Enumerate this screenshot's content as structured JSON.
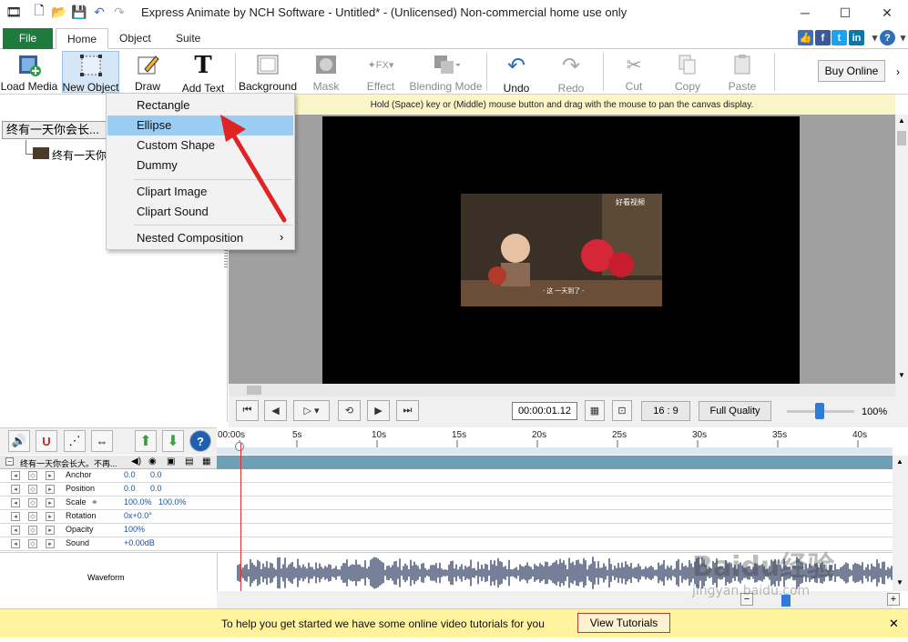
{
  "window": {
    "title": "Express Animate by NCH Software - Untitled* - (Unlicensed) Non-commercial home use only",
    "minimize": "─",
    "maximize": "☐",
    "close": "✕"
  },
  "tabs": [
    {
      "label": "File"
    },
    {
      "label": "Home"
    },
    {
      "label": "Object"
    },
    {
      "label": "Suite"
    }
  ],
  "ribbon": {
    "load_media": "Load Media",
    "new_object": "New Object",
    "draw": "Draw",
    "add_text": "Add Text",
    "background": "Background",
    "mask": "Mask",
    "effect": "Effect",
    "blending_mode": "Blending Mode",
    "undo": "Undo",
    "redo": "Redo",
    "cut": "Cut",
    "copy": "Copy",
    "paste": "Paste",
    "buy_online": "Buy Online"
  },
  "tree": {
    "root": "终有一天你会长...",
    "child": "终有一天你"
  },
  "hint": "Hold (Space) key or (Middle) mouse button and drag with the mouse to pan the canvas display.",
  "video_subtitle": "- 这 一天到了 -",
  "video_logo": "好看视频",
  "transport": {
    "timecode": "00:00:01.12",
    "aspect": "16 : 9",
    "quality": "Full Quality",
    "zoom": "100%",
    "zoom_level": 0.6
  },
  "ruler": [
    "00:00s",
    "5s",
    "10s",
    "15s",
    "20s",
    "25s",
    "30s",
    "35s",
    "40s"
  ],
  "layer": {
    "name": "终有一天你会长大。不再..."
  },
  "properties": [
    {
      "name": "Anchor",
      "v1": "0.0",
      "v2": "0.0"
    },
    {
      "name": "Position",
      "v1": "0.0",
      "v2": "0.0"
    },
    {
      "name": "Scale",
      "v1": "100.0%",
      "v2": "100.0%"
    },
    {
      "name": "Rotation",
      "v1": "0x+0.0°",
      "v2": ""
    },
    {
      "name": "Opacity",
      "v1": "100%",
      "v2": ""
    },
    {
      "name": "Sound",
      "v1": "+0.00dB",
      "v2": ""
    }
  ],
  "waveform_label": "Waveform",
  "notice": {
    "text": "To help you get started we have some online video tutorials for you",
    "button": "View Tutorials",
    "close": "✕"
  },
  "menu": {
    "items": [
      {
        "label": "Rectangle"
      },
      {
        "label": "Ellipse"
      },
      {
        "label": "Custom Shape"
      },
      {
        "label": "Dummy"
      },
      {
        "label": "Clipart Image"
      },
      {
        "label": "Clipart Sound"
      },
      {
        "label": "Nested Composition"
      }
    ],
    "submenu_arrow": "›"
  },
  "watermark": "Baidu经验",
  "watermark_url": "jingyan.baidu.com",
  "colors": {
    "file_tab": "#1e7a3d",
    "menu_highlight": "#9bcdf3",
    "layer_bar": "#6e9fb5",
    "playhead": "#e03131",
    "notice_bg": "#fff39e",
    "arrow": "#e02424"
  }
}
